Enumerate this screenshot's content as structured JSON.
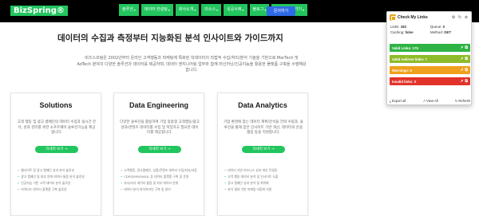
{
  "header": {
    "logo": "BizSpring®",
    "nav": [
      {
        "label": "솔루션"
      },
      {
        "label": "데이터 컨설팅"
      },
      {
        "label": "회사소개"
      },
      {
        "label": "리소스"
      },
      {
        "label": "성공사례"
      },
      {
        "label": "블로그"
      },
      {
        "label": "서비스 바로가기"
      }
    ],
    "consult_label": "문의하기"
  },
  "hero": {
    "title": "데이터의 수집과 측정부터 지능화된 분석 인사이트와 가이드까지",
    "desc_line1": "비즈스프링은 2002년부터 온라인 고객행동과 마케팅에 특화된 빅데이터의 직접적 수집/처리/분석 기술을 기반으로 MarTech 및",
    "desc_line2": "AdTech 분야의 다양한 솔루션과 데이터를 제공하며, 데이터 엔지니어링 업무와 함께 머신러닝/인공지능을 활용한 플랫폼 구축을 수행해왔",
    "desc_line3": "습니다."
  },
  "cards": [
    {
      "title": "Solutions",
      "desc": "고객 행동 및 광고 캠페인의 데이터 수집과 실시간 분석, 성과 관리를 위한 소프트웨어 솔루션기능을 제공합니다.",
      "button": "자세히 보기 →",
      "items": [
        "웹사이트 및 광고 캠페인 성과 분석 솔루션",
        "광고 캠페인 및 외부 연계 데이터 통합 분석 솔루션",
        "인공지능 기반 고객 데이터 분석 솔루션",
        "커넥티드 데이터 플랫폼 구축 솔루션"
      ]
    },
    {
      "title": "Data Engineering",
      "desc": "다양한 솔루션을 활용하여 기업 맞춤형 고객행동/광고성과/콘텐츠 데이터를 수집 및 저장하고 필요한 데이터를 제공합니다.",
      "button": "자세히 보기 →",
      "items": [
        "고객행동, 광고캠페인, 상품/콘텐츠 데이터 수집/처리/저장",
        "CDP/DMP/DW/DL 등 데이터 플랫폼 구축 및 운영",
        "자사/타사 데이터 통합 및 외부 데이터 연계",
        "데이터 분석 파이프라인 구축 및 관리"
      ]
    },
    {
      "title": "Data Analytics",
      "desc": "기업 환경에 맞는 데이터 계획/분석을 전략 수립과, 솔루션을 통해 얻은 인사이트 기반 개선, 데이터의 운용 활용 등을 지원합니다.",
      "button": "자세히 보기 →",
      "items": [
        "데이터 기반 비즈니스 성과 개선 컨설팅",
        "고객 행동 데이터 분석 및 인사이트 도출",
        "광고 캠페인 성과 분석 및 최적화",
        "분석 결과 기반 마케팅 자동화 지원"
      ]
    }
  ],
  "popup": {
    "title": "Check My Links",
    "stats": [
      {
        "label": "Links:",
        "value": "182"
      },
      {
        "label": "Queue:",
        "value": "0"
      },
      {
        "label": "Caching:",
        "value": "false"
      },
      {
        "label": "Method:",
        "value": "GET"
      }
    ],
    "bars": [
      {
        "label": "Valid Links: 175",
        "color": "#2fb344"
      },
      {
        "label": "Valid redirect links: 7",
        "color": "#8dbb2a"
      },
      {
        "label": "Warnings: 0",
        "color": "#f0a01c"
      },
      {
        "label": "Invalid links: 0",
        "color": "#e2332a"
      }
    ],
    "footer": {
      "export": "Export all",
      "view": "View All",
      "refresh": "Refresh"
    }
  }
}
